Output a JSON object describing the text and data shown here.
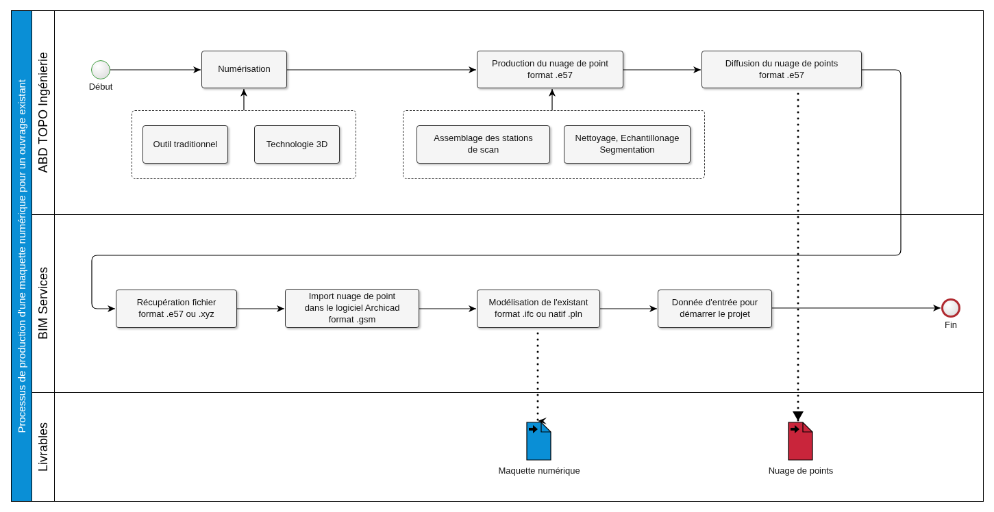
{
  "pool": {
    "title": "Processus de production d'une maquette numérique pour un ouvrage existant"
  },
  "lanes": [
    {
      "name": "ABD TOPO Ingénierie"
    },
    {
      "name": "BIM Services"
    },
    {
      "name": "Livrables"
    }
  ],
  "events": [
    {
      "kind": "start",
      "label": "Début"
    },
    {
      "kind": "end",
      "label": "Fin"
    }
  ],
  "tasks": [
    "Numérisation",
    "Production du nuage de point\nformat .e57",
    "Diffusion du nuage de points\nformat .e57",
    "Récupération fichier\nformat .e57 ou .xyz",
    "Import nuage de point\ndans le logiciel Archicad\nformat .gsm",
    "Modélisation de l'existant\nformat .ifc ou natif .pln",
    "Donnée d'entrée pour\ndémarrer le projet"
  ],
  "groups": [
    {
      "tasks": [
        "Outil traditionnel",
        "Technologie 3D"
      ]
    },
    {
      "tasks": [
        "Assemblage des stations\nde scan",
        "Nettoyage, Echantillonage\nSegmentation"
      ]
    }
  ],
  "deliverables": [
    {
      "label": "Maquette numérique",
      "color": "#0a8fd6"
    },
    {
      "label": "Nuage de points",
      "color": "#c9253b"
    }
  ]
}
